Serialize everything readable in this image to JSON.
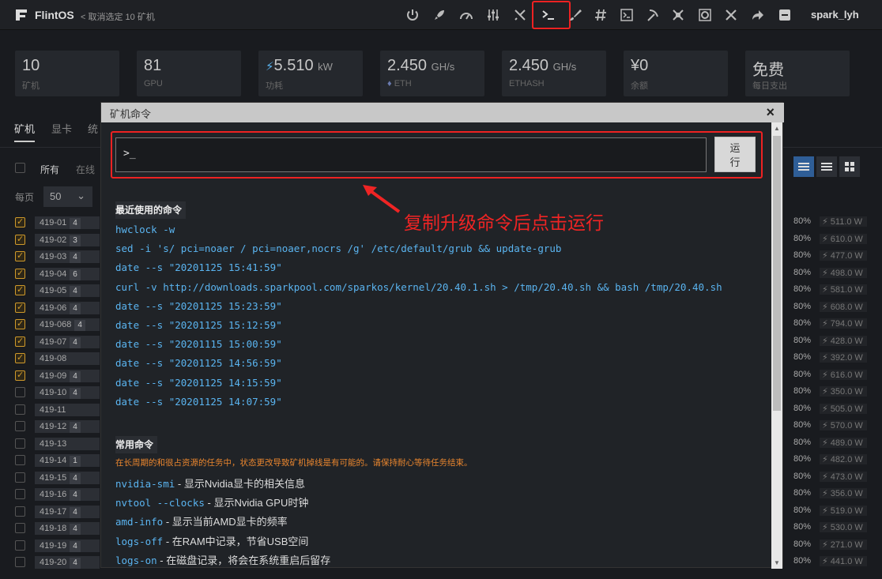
{
  "topbar": {
    "brand": "FlintOS",
    "breadcrumb": "< 取消选定 10 矿机",
    "icons": [
      "power-icon",
      "rocket-icon",
      "gauge-icon",
      "sliders-icon",
      "tools-icon",
      "terminal-icon",
      "brush-icon",
      "hash-icon",
      "console-icon",
      "pickaxe-icon",
      "drone-icon",
      "fan-icon",
      "wrench-screwdriver-icon",
      "share-icon",
      "minus-square-icon"
    ],
    "user": "spark_lyh"
  },
  "stats": [
    {
      "value": "10",
      "unit": "",
      "label": "矿机"
    },
    {
      "value": "81",
      "unit": "",
      "label": "GPU"
    },
    {
      "value": "5.510",
      "unit": "kW",
      "label": "功耗"
    },
    {
      "value": "2.450",
      "unit": "GH/s",
      "label": "ETH"
    },
    {
      "value": "2.450",
      "unit": "GH/s",
      "label": "ETHASH"
    },
    {
      "value": "¥0",
      "unit": "",
      "label": "余额"
    },
    {
      "value": "免费",
      "unit": "",
      "label": "每日支出"
    }
  ],
  "tabs": [
    "矿机",
    "显卡",
    "统"
  ],
  "filters": {
    "all": "所有",
    "online": "在线",
    "per_page_label": "每页",
    "per_page": "50"
  },
  "rows": [
    {
      "name": "419-01",
      "count": "4",
      "checked": true,
      "pct": "80%",
      "power": "511.0 W"
    },
    {
      "name": "419-02",
      "count": "3",
      "checked": true,
      "pct": "80%",
      "power": "610.0 W"
    },
    {
      "name": "419-03",
      "count": "4",
      "checked": true,
      "pct": "80%",
      "power": "477.0 W"
    },
    {
      "name": "419-04",
      "count": "6",
      "checked": true,
      "pct": "80%",
      "power": "498.0 W"
    },
    {
      "name": "419-05",
      "count": "4",
      "checked": true,
      "pct": "80%",
      "power": "581.0 W"
    },
    {
      "name": "419-06",
      "count": "4",
      "checked": true,
      "pct": "80%",
      "power": "608.0 W"
    },
    {
      "name": "419-068",
      "count": "4",
      "checked": true,
      "pct": "80%",
      "power": "794.0 W"
    },
    {
      "name": "419-07",
      "count": "4",
      "checked": true,
      "pct": "80%",
      "power": "428.0 W"
    },
    {
      "name": "419-08",
      "count": "",
      "checked": true,
      "pct": "80%",
      "power": "392.0 W"
    },
    {
      "name": "419-09",
      "count": "4",
      "checked": true,
      "pct": "80%",
      "power": "616.0 W"
    },
    {
      "name": "419-10",
      "count": "4",
      "checked": false,
      "pct": "80%",
      "power": "350.0 W"
    },
    {
      "name": "419-11",
      "count": "",
      "checked": false,
      "pct": "80%",
      "power": "505.0 W"
    },
    {
      "name": "419-12",
      "count": "4",
      "checked": false,
      "pct": "80%",
      "power": "570.0 W"
    },
    {
      "name": "419-13",
      "count": "",
      "checked": false,
      "pct": "80%",
      "power": "489.0 W"
    },
    {
      "name": "419-14",
      "count": "1",
      "checked": false,
      "pct": "80%",
      "power": "482.0 W"
    },
    {
      "name": "419-15",
      "count": "4",
      "checked": false,
      "pct": "80%",
      "power": "473.0 W"
    },
    {
      "name": "419-16",
      "count": "4",
      "checked": false,
      "pct": "80%",
      "power": "356.0 W"
    },
    {
      "name": "419-17",
      "count": "4",
      "checked": false,
      "pct": "80%",
      "power": "519.0 W"
    },
    {
      "name": "419-18",
      "count": "4",
      "checked": false,
      "pct": "80%",
      "power": "530.0 W"
    },
    {
      "name": "419-19",
      "count": "4",
      "checked": false,
      "pct": "80%",
      "power": "271.0 W"
    },
    {
      "name": "419-20",
      "count": "4",
      "checked": false,
      "pct": "80%",
      "power": "441.0 W"
    }
  ],
  "modal": {
    "title": "矿机命令",
    "close": "×",
    "input_value": ">_",
    "run_label": "运行",
    "hint": "复制升级命令后点击运行",
    "recent_title": "最近使用的命令",
    "recent": [
      "hwclock -w",
      "sed -i 's/ pci=noaer / pci=noaer,nocrs /g' /etc/default/grub && update-grub",
      "date --s \"20201125 15:41:59\"",
      "curl -v http://downloads.sparkpool.com/sparkos/kernel/20.40.1.sh > /tmp/20.40.sh && bash /tmp/20.40.sh",
      "date --s \"20201125 15:23:59\"",
      "date --s \"20201125 15:12:59\"",
      "date --s \"20201115 15:00:59\"",
      "date --s \"20201125 14:56:59\"",
      "date --s \"20201125 14:15:59\"",
      "date --s \"20201125 14:07:59\""
    ],
    "common_title": "常用命令",
    "warning": "在长周期的和很占资源的任务中，状态更改导致矿机掉线是有可能的。请保持耐心等待任务结束。",
    "common": [
      {
        "cmd": "nvidia-smi",
        "desc": " - 显示Nvidia显卡的相关信息"
      },
      {
        "cmd": "nvtool --clocks",
        "desc": " - 显示Nvidia GPU时钟"
      },
      {
        "cmd": "amd-info",
        "desc": " - 显示当前AMD显卡的频率"
      },
      {
        "cmd": "logs-off",
        "desc": " - 在RAM中记录，节省USB空间"
      },
      {
        "cmd": "logs-on",
        "desc": " - 在磁盘记录，将会在系统重启后留存"
      }
    ]
  },
  "colors": {
    "accent_red": "#ef2424",
    "checkbox": "#d09a2a",
    "command_blue": "#5ab4f0",
    "warning": "#e8852e"
  }
}
